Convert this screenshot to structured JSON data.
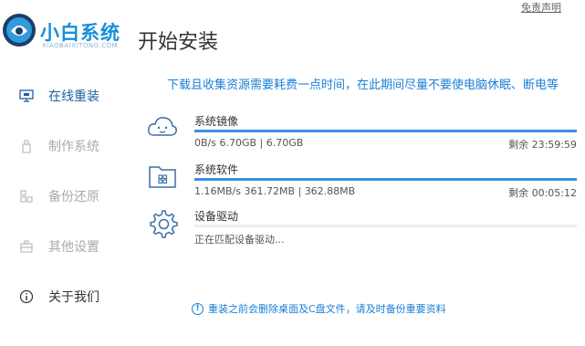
{
  "header": {
    "logo_text": "小白系统",
    "logo_sub": "XIAOBAIXITONG.COM",
    "page_title": "开始安装",
    "disclaimer": "免责声明"
  },
  "sidebar": {
    "items": [
      {
        "label": "在线重装",
        "icon": "monitor-icon",
        "active": true
      },
      {
        "label": "制作系统",
        "icon": "usb-icon",
        "active": false
      },
      {
        "label": "备份还原",
        "icon": "backup-icon",
        "active": false
      },
      {
        "label": "其他设置",
        "icon": "briefcase-icon",
        "active": false
      },
      {
        "label": "关于我们",
        "icon": "info-icon",
        "active": false
      }
    ]
  },
  "main": {
    "notice": "下载且收集资源需要耗费一点时间，在此期间尽量不要使电脑休眠、断电等",
    "tasks": [
      {
        "name": "系统镜像",
        "detail": "0B/s 6.70GB | 6.70GB",
        "eta": "剩余 23:59:59",
        "icon": "cloud-face-icon",
        "progress": 1.0
      },
      {
        "name": "系统软件",
        "detail": "1.16MB/s 361.72MB | 362.88MB",
        "eta": "剩余 00:05:12",
        "icon": "folder-icon",
        "progress": 1.0
      },
      {
        "name": "设备驱动",
        "detail": "正在匹配设备驱动...",
        "eta": "",
        "icon": "gear-icon",
        "progress": 0.0
      }
    ],
    "footer_note": "重装之前会删除桌面及C盘文件，请及时备份重要资料"
  },
  "colors": {
    "brand": "#1890d8",
    "accent_text": "#1a7fd6",
    "active_nav": "#1f5fa5",
    "progress": "#3a90e0",
    "track": "#e8eef5"
  }
}
